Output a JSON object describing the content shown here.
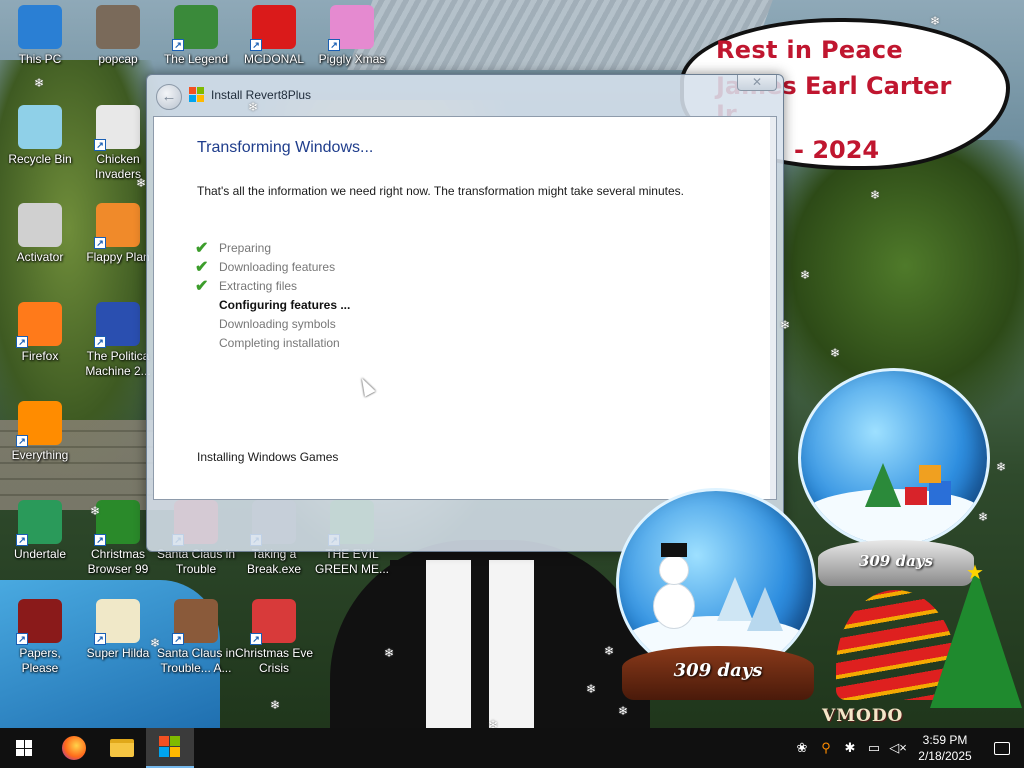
{
  "memorial": {
    "line1": "Rest in Peace",
    "line2": "James Earl Carter Jr.",
    "line3": "- 2024"
  },
  "desktop_icons": [
    {
      "label": "This PC",
      "icon": "computer-icon",
      "color": "#2a7fd4"
    },
    {
      "label": "popcap",
      "icon": "popcap-icon",
      "color": "#7a6a5a"
    },
    {
      "label": "The Legend",
      "icon": "legend-icon",
      "color": "#3a8a3a"
    },
    {
      "label": "MCDONAL",
      "icon": "mcdonalds-icon",
      "color": "#da1a1a"
    },
    {
      "label": "Piggly Xmas",
      "icon": "piggly-icon",
      "color": "#e58ad0"
    },
    {
      "label": "Recycle Bin",
      "icon": "recycle-bin-icon",
      "color": "#8fd0e8"
    },
    {
      "label": "Chicken Invaders",
      "icon": "chicken-icon",
      "color": "#e8e8e8"
    },
    {
      "label": "Activator",
      "icon": "activator-icon",
      "color": "#d0d0d0"
    },
    {
      "label": "Flappy Plan",
      "icon": "flappy-icon",
      "color": "#f08a2a"
    },
    {
      "label": "Firefox",
      "icon": "firefox-icon",
      "color": "#ff7a1a"
    },
    {
      "label": "The Politica Machine 2...",
      "icon": "politica-icon",
      "color": "#2a4fb0"
    },
    {
      "label": "Everything",
      "icon": "everything-icon",
      "color": "#ff8c00"
    },
    {
      "label": "Undertale",
      "icon": "undertale-icon",
      "color": "#2a9a5a"
    },
    {
      "label": "Christmas Browser 99",
      "icon": "christmas-browser-icon",
      "color": "#2a8a2a"
    },
    {
      "label": "Santa Claus in Trouble",
      "icon": "santa-trouble-icon",
      "color": "#c82a2a"
    },
    {
      "label": "Taking a Break.exe",
      "icon": "taking-break-icon",
      "color": "#555555"
    },
    {
      "label": "THE EVIL GREEN ME...",
      "icon": "evil-green-icon",
      "color": "#3a8a2a"
    },
    {
      "label": "Papers, Please",
      "icon": "papers-please-icon",
      "color": "#8a1a1a"
    },
    {
      "label": "Super Hilda",
      "icon": "super-hilda-icon",
      "color": "#f0e8c8"
    },
    {
      "label": "Santa Claus in Trouble... A...",
      "icon": "santa-trouble-2-icon",
      "color": "#8a5a3a"
    },
    {
      "label": "Christmas Eve Crisis",
      "icon": "xmas-eve-icon",
      "color": "#d83a3a"
    }
  ],
  "window": {
    "title": "Install Revert8Plus",
    "close_label": "✕",
    "back_label": "←",
    "heading": "Transforming Windows...",
    "info": "That's all the information we need right now. The transformation might take several minutes.",
    "steps": [
      {
        "label": "Preparing",
        "state": "done"
      },
      {
        "label": "Downloading features",
        "state": "done"
      },
      {
        "label": "Extracting files",
        "state": "done"
      },
      {
        "label": "Configuring features ...",
        "state": "current"
      },
      {
        "label": "Downloading symbols",
        "state": "pending"
      },
      {
        "label": "Completing installation",
        "state": "pending"
      }
    ],
    "status": "Installing Windows Games"
  },
  "globes": {
    "large_label": "309 days",
    "small_label": "309 days"
  },
  "decor_text": "VMODO",
  "taskbar": {
    "clock_time": "3:59 PM",
    "clock_date": "2/18/2025"
  },
  "colors": {
    "heading": "#1f3d8c",
    "check": "#3c9d2b",
    "memorial_text": "#c0162f"
  }
}
